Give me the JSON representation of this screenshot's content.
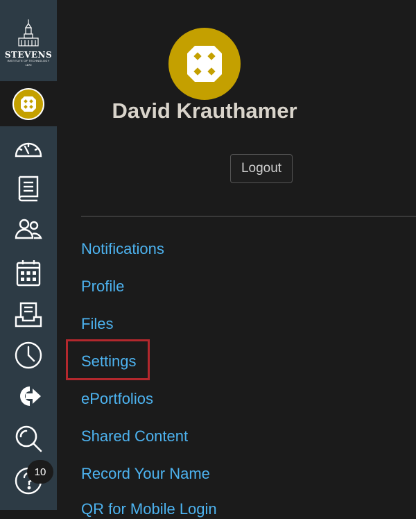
{
  "brand": {
    "name": "STEVENS",
    "subtitle": "INSTITUTE OF TECHNOLOGY",
    "year": "1870",
    "colors": {
      "sidebar": "#2d3b45",
      "background": "#1b1b1b",
      "link": "#4db3f0",
      "avatar": "#c4a000",
      "highlight": "#b3282d"
    }
  },
  "global_nav": {
    "items": [
      {
        "name": "account",
        "icon": "account-avatar-icon"
      },
      {
        "name": "dashboard",
        "icon": "dashboard-gauge-icon"
      },
      {
        "name": "courses",
        "icon": "book-icon"
      },
      {
        "name": "groups",
        "icon": "people-icon"
      },
      {
        "name": "calendar",
        "icon": "calendar-icon"
      },
      {
        "name": "inbox",
        "icon": "inbox-icon"
      },
      {
        "name": "history",
        "icon": "clock-icon"
      },
      {
        "name": "commons",
        "icon": "commons-arrow-icon"
      },
      {
        "name": "search",
        "icon": "search-icon"
      },
      {
        "name": "help",
        "icon": "help-icon"
      }
    ],
    "help_badge": "10"
  },
  "user": {
    "name": "David Krauthamer",
    "logout_label": "Logout"
  },
  "menu": {
    "items": [
      {
        "label": "Notifications"
      },
      {
        "label": "Profile"
      },
      {
        "label": "Files"
      },
      {
        "label": "Settings",
        "highlighted": true
      },
      {
        "label": "ePortfolios"
      },
      {
        "label": "Shared Content"
      },
      {
        "label": "Record Your Name"
      },
      {
        "label": "QR for Mobile Login"
      }
    ]
  }
}
